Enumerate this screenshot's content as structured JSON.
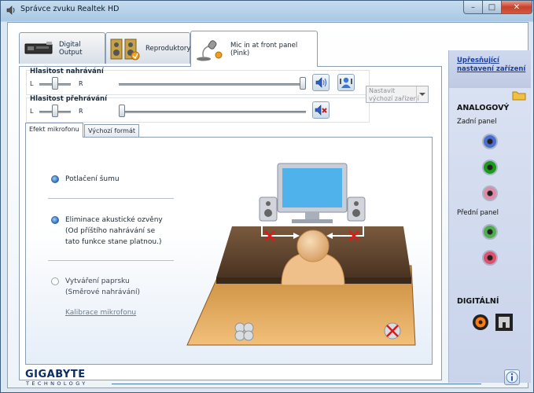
{
  "window": {
    "title": "Správce zvuku Realtek HD",
    "controls": {
      "minimize": "–",
      "maximize": "□",
      "close": "✕"
    }
  },
  "tabs": [
    {
      "label": "Digital Output",
      "icon": "digital-output-device-icon",
      "active": false
    },
    {
      "label": "Reproduktory",
      "icon": "speakers-icon",
      "active": false
    },
    {
      "label": "Mic in at front panel (Pink)",
      "icon": "microphone-icon",
      "active": true
    }
  ],
  "recording_volume": {
    "label": "Hlasitost nahrávání",
    "left": "L",
    "right": "R",
    "balance_percent": 50,
    "volume_percent": 100
  },
  "playback_volume": {
    "label": "Hlasitost přehrávání",
    "left": "L",
    "right": "R",
    "balance_percent": 50,
    "volume_percent": 0
  },
  "default_device_button": {
    "line1": "Nastavit",
    "line2": "výchozí zařízení"
  },
  "subtabs": [
    {
      "label": "Efekt mikrofonu",
      "active": true
    },
    {
      "label": "Výchozí formát",
      "active": false
    }
  ],
  "mic_effects": [
    {
      "lines": [
        "Potlačení šumu"
      ],
      "selected": true
    },
    {
      "lines": [
        "Eliminace akustické ozvěny",
        "(Od příštího nahrávání se",
        "tato funkce stane platnou.)"
      ],
      "selected": true
    },
    {
      "lines": [
        "Vytváření paprsku",
        "(Směrové nahrávání)"
      ],
      "selected": false
    }
  ],
  "calibration_link": "Kalibrace mikrofonu",
  "side": {
    "advanced_link_line1": "Upřesňující",
    "advanced_link_line2": "nastavení zařízení",
    "analog_heading": "ANALOGOVÝ",
    "rear_panel": "Zadní panel",
    "front_panel": "Přední panel",
    "digital_heading": "DIGITÁLNÍ",
    "rear_jacks": [
      "#4b6fd0",
      "#1a9a1a",
      "#e08aa8"
    ],
    "front_jacks": [
      "#4fae4f",
      "#e0506e"
    ]
  },
  "brand": {
    "name": "GIGABYTE",
    "tagline": "TECHNOLOGY"
  }
}
